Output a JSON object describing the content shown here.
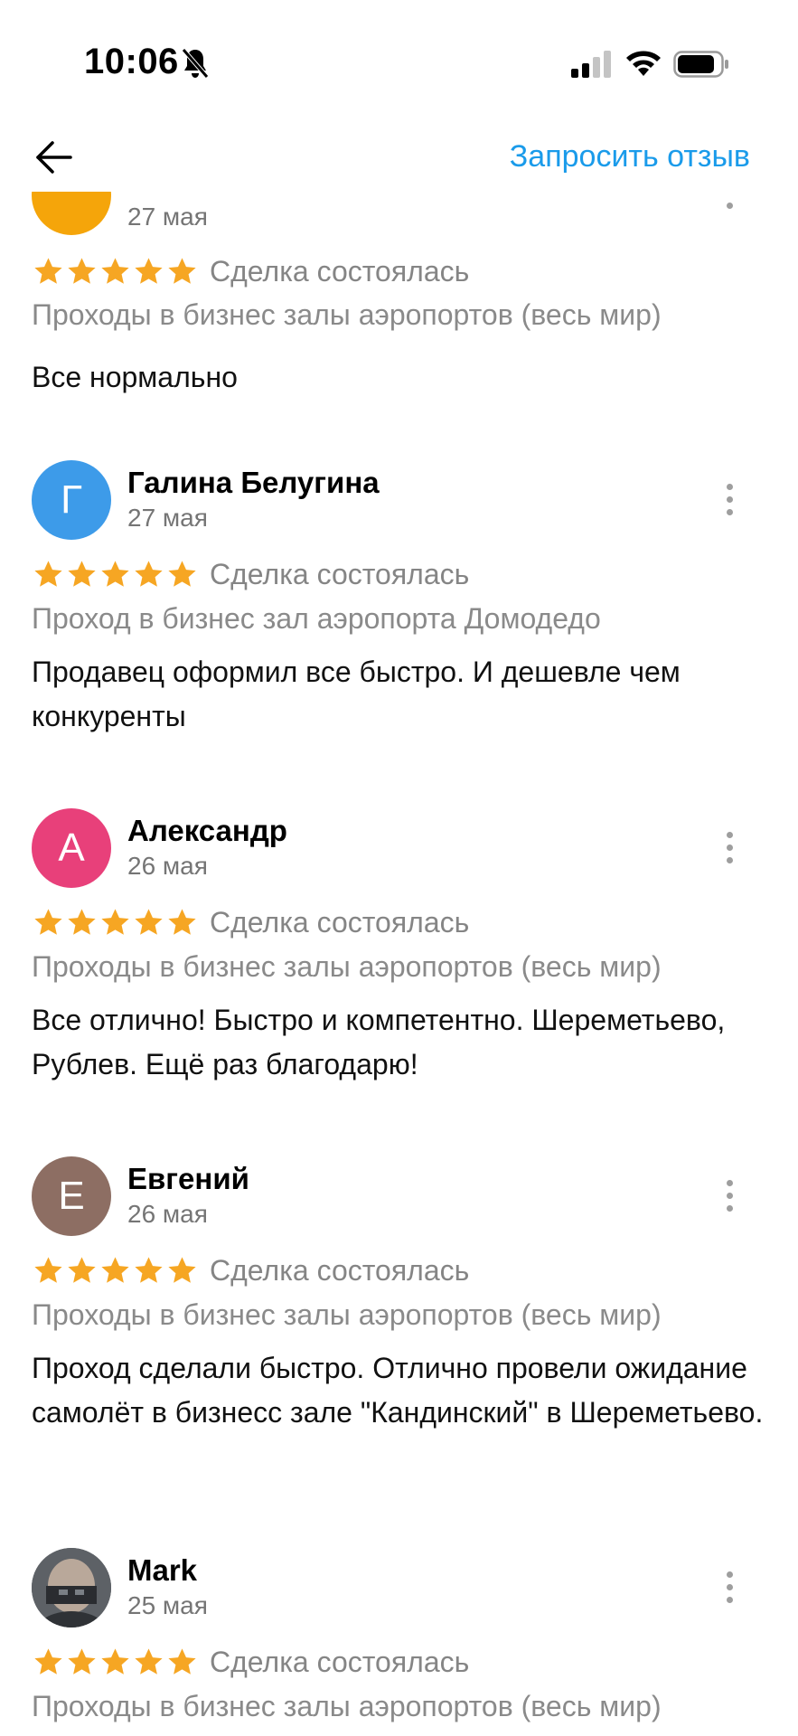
{
  "status_bar": {
    "time": "10:06",
    "icons": [
      "bell-muted-icon",
      "signal-icon",
      "wifi-icon",
      "battery-icon"
    ]
  },
  "nav": {
    "back_icon": "arrow-left-icon",
    "request_review_label": "Запросить отзыв"
  },
  "colors": {
    "accent": "#1a9bea",
    "star": "#f6a623"
  },
  "reviews": [
    {
      "author": "",
      "date": "27 мая",
      "avatar_letter": "",
      "avatar_color": "#f5a50a",
      "rating": 5,
      "status": "Сделка состоялась",
      "product": "Проходы в бизнес залы аэропортов (весь мир)",
      "text": "Все нормально"
    },
    {
      "author": "Галина Белугина",
      "date": "27 мая",
      "avatar_letter": "Г",
      "avatar_color": "#3d9be9",
      "rating": 5,
      "status": "Сделка состоялась",
      "product": "Проход в бизнес зал аэропорта Домодедо",
      "text": "Продавец оформил все быстро. И дешевле чем конкуренты"
    },
    {
      "author": "Александр",
      "date": "26 мая",
      "avatar_letter": "А",
      "avatar_color": "#e8407a",
      "rating": 5,
      "status": "Сделка состоялась",
      "product": "Проходы в бизнес залы аэропортов (весь мир)",
      "text": "Все отлично! Быстро и компетентно. Шереметьево, Рублев. Ещё раз благодарю!"
    },
    {
      "author": "Евгений",
      "date": "26 мая",
      "avatar_letter": "Е",
      "avatar_color": "#8d6e63",
      "rating": 5,
      "status": "Сделка состоялась",
      "product": "Проходы в бизнес залы аэропортов (весь мир)",
      "text": "Проход сделали быстро. Отлично провели ожидание самолёт в бизнесс зале \"Кандинский\" в Шереметьево."
    },
    {
      "author": "Mark",
      "date": "25 мая",
      "avatar_letter": "",
      "avatar_color": "#4a4f55",
      "rating": 5,
      "status": "Сделка состоялась",
      "product": "Проходы в бизнес залы аэропортов (весь мир)",
      "text": ""
    }
  ]
}
